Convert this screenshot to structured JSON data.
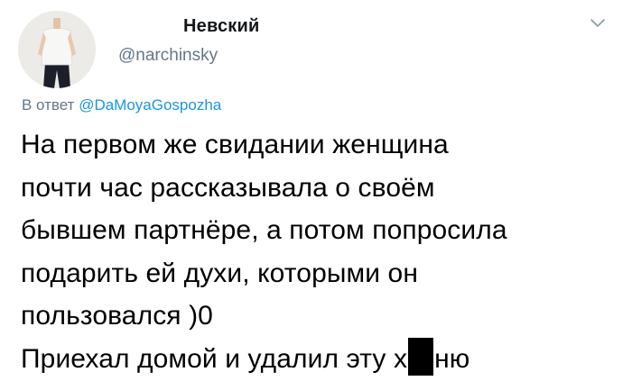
{
  "user": {
    "display_name": "Невский",
    "handle": "@narchinsky"
  },
  "reply": {
    "prefix": "В ответ",
    "mention": "@DaMoyaGospozha"
  },
  "tweet": {
    "lines": [
      "На первом же свидании женщина",
      "почти час рассказывала о своём",
      "бывшем партнёре, а потом попросила",
      "подарить ей духи, которыми он",
      "пользовался )0"
    ],
    "last_line_start": "Приехал домой и удалил эту х",
    "last_line_end": "ню"
  },
  "icons": {
    "menu": "chevron-down-icon",
    "avatar": "avatar-photo"
  },
  "colors": {
    "secondary_text": "#657786",
    "mention": "#1b95e0",
    "text": "#000000"
  }
}
